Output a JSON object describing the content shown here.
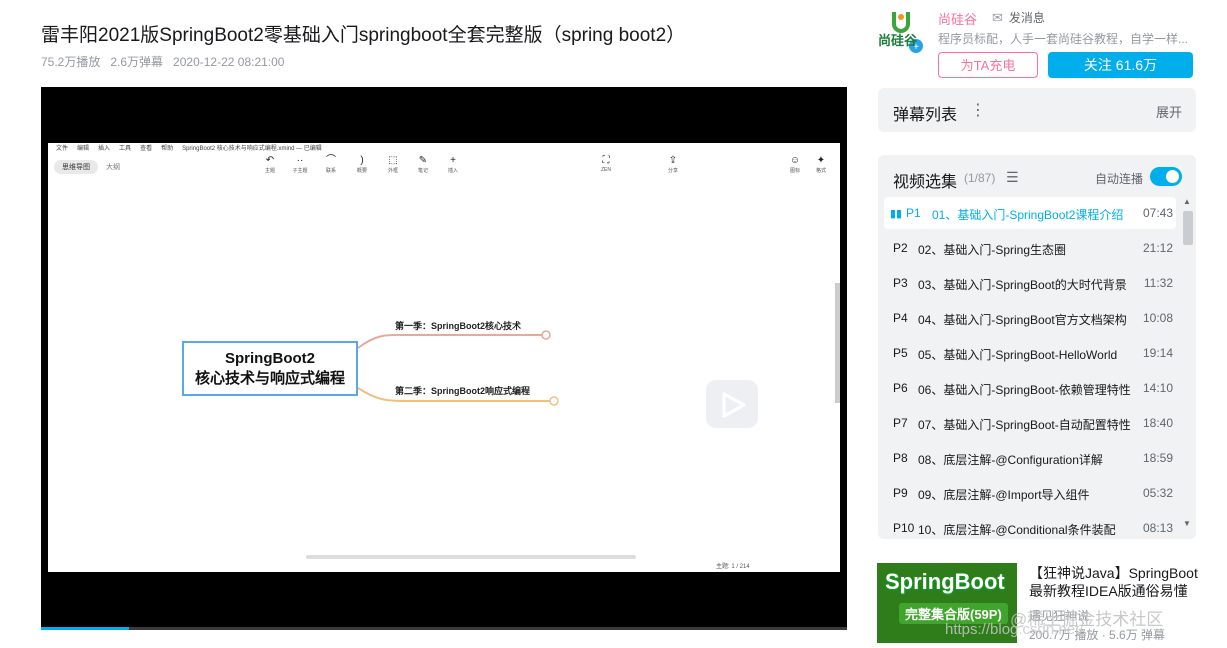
{
  "video": {
    "title": "雷丰阳2021版SpringBoot2零基础入门springboot全套完整版（spring boot2）",
    "plays": "75.2万播放",
    "danmaku_count": "2.6万弹幕",
    "date": "2020-12-22 08:21:00"
  },
  "screen": {
    "menu": [
      "文件",
      "编辑",
      "插入",
      "工具",
      "查看",
      "帮助"
    ],
    "doc_title": "SpringBoot2 核心技术与响应式编程.xmind — 已编辑",
    "modes": [
      "思维导图",
      "大纲"
    ],
    "tools": [
      {
        "icon": "↶",
        "label": "主题"
      },
      {
        "icon": "··",
        "label": "子主题"
      },
      {
        "icon": "⌒",
        "label": "联系"
      },
      {
        "icon": ")",
        "label": "概要"
      },
      {
        "icon": "⬚",
        "label": "外框"
      },
      {
        "icon": "✎",
        "label": "笔记"
      },
      {
        "icon": "+",
        "label": "插入"
      },
      {
        "icon": "⛶",
        "label": "ZEN"
      },
      {
        "icon": "⇪",
        "label": "分享"
      },
      {
        "icon": "☺",
        "label": "图标"
      },
      {
        "icon": "✦",
        "label": "格式"
      }
    ],
    "root_line1": "SpringBoot2",
    "root_line2": "核心技术与响应式编程",
    "branch1": "第一季：SpringBoot2核心技术",
    "branch2": "第二季：SpringBoot2响应式编程",
    "status": "主题: 1 / 214"
  },
  "up": {
    "name": "尚硅谷",
    "message": "发消息",
    "desc": "程序员标配，人手一套尚硅谷教程，自学一样...",
    "charge": "为TA充电",
    "follow": "关注 61.6万",
    "avatar_text": "尚硅谷"
  },
  "danmaku_panel": {
    "title": "弹幕列表",
    "expand": "展开"
  },
  "episodes": {
    "title": "视频选集",
    "count": "(1/87)",
    "autoplay": "自动连播",
    "items": [
      {
        "idx": "P1",
        "label": "01、基础入门-SpringBoot2课程介绍",
        "dur": "07:43"
      },
      {
        "idx": "P2",
        "label": "02、基础入门-Spring生态圈",
        "dur": "21:12"
      },
      {
        "idx": "P3",
        "label": "03、基础入门-SpringBoot的大时代背景",
        "dur": "11:32"
      },
      {
        "idx": "P4",
        "label": "04、基础入门-SpringBoot官方文档架构",
        "dur": "10:08"
      },
      {
        "idx": "P5",
        "label": "05、基础入门-SpringBoot-HelloWorld",
        "dur": "19:14"
      },
      {
        "idx": "P6",
        "label": "06、基础入门-SpringBoot-依赖管理特性",
        "dur": "14:10"
      },
      {
        "idx": "P7",
        "label": "07、基础入门-SpringBoot-自动配置特性",
        "dur": "18:40"
      },
      {
        "idx": "P8",
        "label": "08、底层注解-@Configuration详解",
        "dur": "18:59"
      },
      {
        "idx": "P9",
        "label": "09、底层注解-@Import导入组件",
        "dur": "05:32"
      },
      {
        "idx": "P10",
        "label": "10、底层注解-@Conditional条件装配",
        "dur": "08:13"
      }
    ]
  },
  "recommend": {
    "thumb_line1": "SpringBoot",
    "thumb_line2": "完整集合版(59P)",
    "title": "【狂神说Java】SpringBoot最新教程IDEA版通俗易懂",
    "up": "遇见狂神说",
    "stats": "200.7万 播放 · 5.6万 弹幕"
  },
  "watermark": "@稀土掘金技术社区",
  "watermark_url": "https://blog.csdn.net/..."
}
